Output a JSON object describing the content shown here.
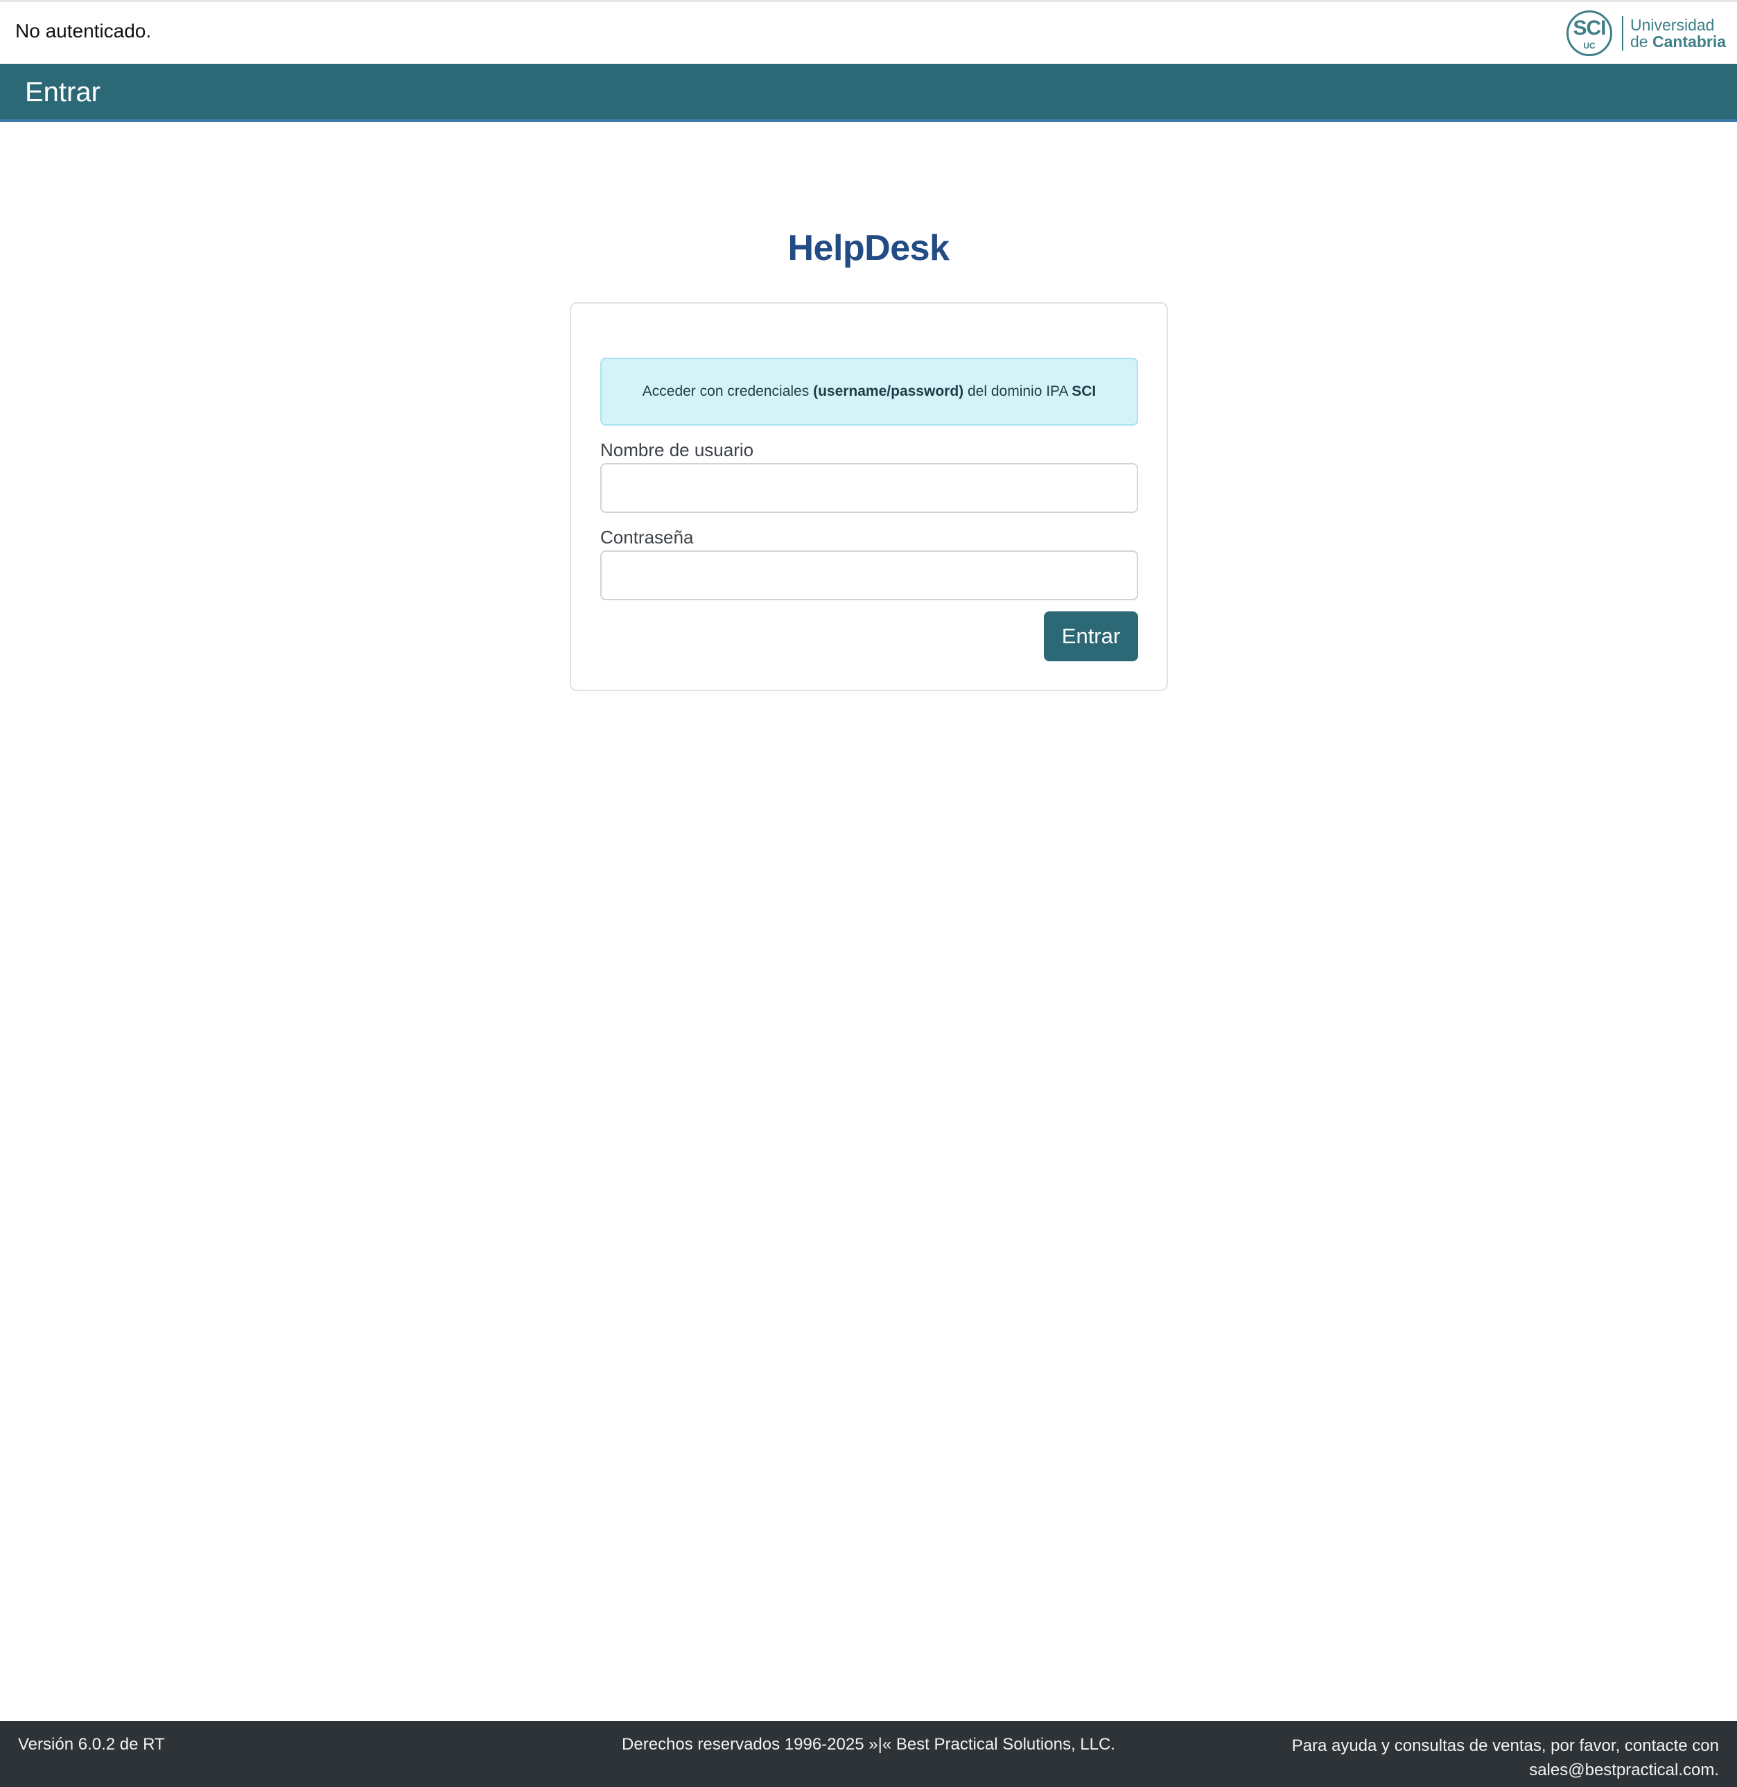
{
  "header": {
    "status": "No autenticado.",
    "logo": {
      "mark": "SCI",
      "mark_sub": "UC",
      "line1": "Universidad",
      "line2_prefix": "de ",
      "line2_bold": "Cantabria"
    }
  },
  "title_bar": {
    "title": "Entrar"
  },
  "main": {
    "app_name": "HelpDesk",
    "login": {
      "info": {
        "prefix": "Acceder con credenciales ",
        "bold_credentials": "(username/password)",
        "middle": " del dominio IPA ",
        "bold_domain": "SCI"
      },
      "username_label": "Nombre de usuario",
      "username_value": "",
      "password_label": "Contraseña",
      "password_value": "",
      "submit_label": "Entrar"
    }
  },
  "footer": {
    "version": "Versión 6.0.2 de RT",
    "copyright": "Derechos reservados 1996-2025 »|« Best Practical Solutions, LLC.",
    "contact_line1": "Para ayuda y consultas de ventas, por favor, contacte con",
    "contact_line2": "sales@bestpractical.com."
  },
  "colors": {
    "brand": "#2c6875",
    "app_name": "#234b84",
    "info_bg": "#d4f3f9",
    "footer_bg": "#2d3337"
  }
}
